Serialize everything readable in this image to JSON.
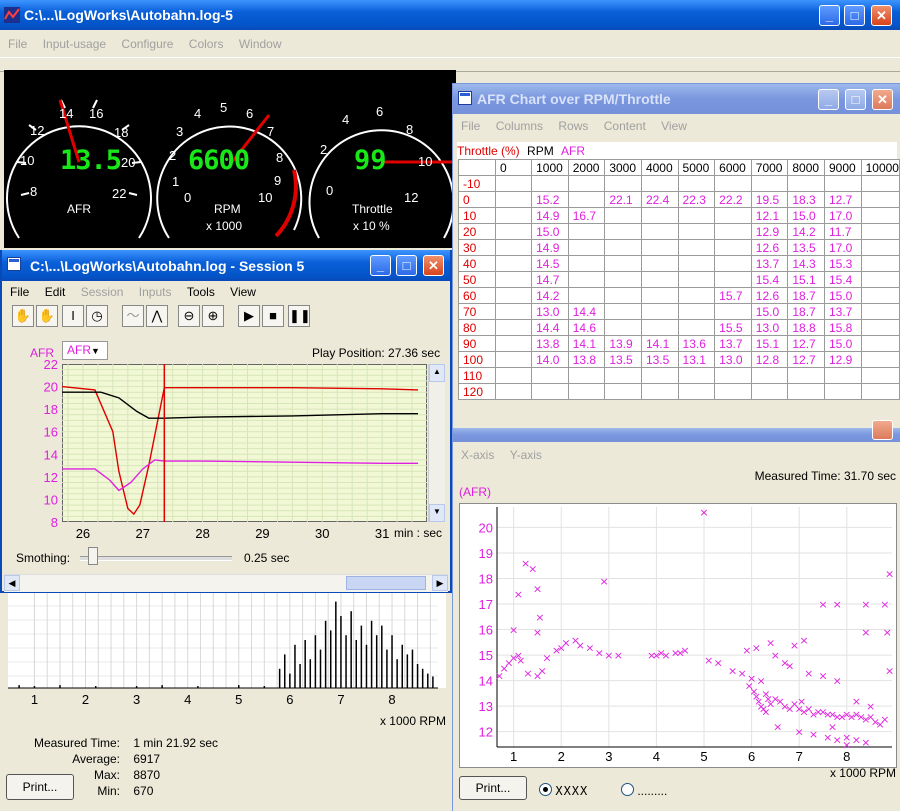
{
  "main_window": {
    "title": "C:\\...\\LogWorks\\Autobahn.log-5",
    "menu": [
      "File",
      "Input-usage",
      "Configure",
      "Colors",
      "Window"
    ],
    "min": "_",
    "max": "□",
    "close": "✕"
  },
  "gauges": {
    "afr": {
      "value": "13.5",
      "label": "AFR",
      "ticks": [
        "8",
        "10",
        "12",
        "14",
        "16",
        "18",
        "20",
        "22"
      ]
    },
    "rpm": {
      "value": "6600",
      "label": "RPM",
      "sub": "x 1000",
      "ticks": [
        "0",
        "1",
        "2",
        "3",
        "4",
        "5",
        "6",
        "7",
        "8",
        "9",
        "10"
      ]
    },
    "throttle": {
      "value": "99",
      "label": "Throttle",
      "sub": "x 10 %",
      "ticks": [
        "0",
        "2",
        "4",
        "6",
        "8",
        "10",
        "12"
      ]
    }
  },
  "afr_chart_window": {
    "title": "AFR Chart over RPM/Throttle",
    "menu": [
      "File",
      "Columns",
      "Rows",
      "Content",
      "View"
    ],
    "legend": {
      "throttle": "Throttle (%)",
      "rpm": "RPM",
      "afr": "AFR"
    },
    "columns": [
      "0",
      "1000",
      "2000",
      "3000",
      "4000",
      "5000",
      "6000",
      "7000",
      "8000",
      "9000",
      "10000"
    ],
    "rows": [
      {
        "label": "-10",
        "cells": [
          "",
          "",
          "",
          "",
          "",
          "",
          "",
          "",
          "",
          "",
          ""
        ]
      },
      {
        "label": "0",
        "cells": [
          "",
          "15.2",
          "",
          "22.1",
          "22.4",
          "22.3",
          "22.2",
          "19.5",
          "18.3",
          "12.7",
          ""
        ]
      },
      {
        "label": "10",
        "cells": [
          "",
          "14.9",
          "16.7",
          "",
          "",
          "",
          "",
          "12.1",
          "15.0",
          "17.0",
          ""
        ]
      },
      {
        "label": "20",
        "cells": [
          "",
          "15.0",
          "",
          "",
          "",
          "",
          "",
          "12.9",
          "14.2",
          "11.7",
          ""
        ]
      },
      {
        "label": "30",
        "cells": [
          "",
          "14.9",
          "",
          "",
          "",
          "",
          "",
          "12.6",
          "13.5",
          "17.0",
          ""
        ]
      },
      {
        "label": "40",
        "cells": [
          "",
          "14.5",
          "",
          "",
          "",
          "",
          "",
          "13.7",
          "14.3",
          "15.3",
          ""
        ]
      },
      {
        "label": "50",
        "cells": [
          "",
          "14.7",
          "",
          "",
          "",
          "",
          "",
          "15.4",
          "15.1",
          "15.4",
          ""
        ]
      },
      {
        "label": "60",
        "cells": [
          "",
          "14.2",
          "",
          "",
          "",
          "",
          "15.7",
          "12.6",
          "18.7",
          "15.0",
          ""
        ]
      },
      {
        "label": "70",
        "cells": [
          "",
          "13.0",
          "14.4",
          "",
          "",
          "",
          "",
          "15.0",
          "18.7",
          "13.7",
          ""
        ]
      },
      {
        "label": "80",
        "cells": [
          "",
          "14.4",
          "14.6",
          "",
          "",
          "",
          "15.5",
          "13.0",
          "18.8",
          "15.8",
          ""
        ]
      },
      {
        "label": "90",
        "cells": [
          "",
          "13.8",
          "14.1",
          "13.9",
          "14.1",
          "13.6",
          "13.7",
          "15.1",
          "12.7",
          "15.0",
          ""
        ]
      },
      {
        "label": "100",
        "cells": [
          "",
          "14.0",
          "13.8",
          "13.5",
          "13.5",
          "13.1",
          "13.0",
          "12.8",
          "12.7",
          "12.9",
          ""
        ]
      },
      {
        "label": "110",
        "cells": [
          "",
          "",
          "",
          "",
          "",
          "",
          "",
          "",
          "",
          "",
          ""
        ]
      },
      {
        "label": "120",
        "cells": [
          "",
          "",
          "",
          "",
          "",
          "",
          "",
          "",
          "",
          "",
          ""
        ]
      }
    ]
  },
  "session_window": {
    "title": "C:\\...\\LogWorks\\Autobahn.log - Session 5",
    "menu": [
      {
        "label": "File",
        "enabled": true
      },
      {
        "label": "Edit",
        "enabled": true
      },
      {
        "label": "Session",
        "enabled": false
      },
      {
        "label": "Inputs",
        "enabled": false
      },
      {
        "label": "Tools",
        "enabled": true
      },
      {
        "label": "View",
        "enabled": true
      }
    ],
    "channel_label": "AFR",
    "channel_select": "AFR",
    "play_position": "Play Position: 27.36 sec",
    "x_ticks": [
      "26",
      "27",
      "28",
      "29",
      "30",
      "31"
    ],
    "x_unit": "min : sec",
    "y_ticks": [
      "22",
      "20",
      "18",
      "16",
      "14",
      "12",
      "10",
      "8"
    ],
    "smoothing_label": "Smothing:",
    "smoothing_value": "0.25 sec",
    "smoothing_level": 0.05
  },
  "histogram_panel": {
    "x_ticks": [
      "1",
      "2",
      "3",
      "4",
      "5",
      "6",
      "7",
      "8"
    ],
    "x_unit": "x 1000 RPM",
    "stats": [
      {
        "label": "Measured Time:",
        "value": "1 min 21.92 sec"
      },
      {
        "label": "Average:",
        "value": "6917"
      },
      {
        "label": "Max:",
        "value": "8870"
      },
      {
        "label": "Min:",
        "value": "670"
      }
    ],
    "print_label": "Print..."
  },
  "xy_plot_window": {
    "menu": [
      "X-axis",
      "Y-axis"
    ],
    "measured_time": "Measured Time: 31.70 sec",
    "y_label": "(AFR)",
    "x_unit": "x 1000 RPM",
    "print_label": "Print...",
    "radio_1": "XXXX",
    "radio_2": "........."
  },
  "chart_data": [
    {
      "type": "line",
      "xlabel": "min : sec",
      "ylabel": "AFR",
      "x": [
        "26",
        "27",
        "28",
        "29",
        "30",
        "31"
      ],
      "ylim": [
        8,
        22
      ],
      "series": [
        {
          "color": "#e00000",
          "points": [
            [
              25.65,
              20.0
            ],
            [
              26.2,
              19.7
            ],
            [
              26.5,
              16.0
            ],
            [
              26.6,
              12.5
            ],
            [
              26.75,
              9.2
            ],
            [
              26.85,
              8.7
            ],
            [
              26.95,
              9.5
            ],
            [
              27.1,
              13.0
            ],
            [
              27.25,
              17.0
            ],
            [
              27.36,
              19.9
            ],
            [
              28.0,
              19.9
            ],
            [
              29.5,
              19.9
            ],
            [
              31.0,
              19.8
            ],
            [
              31.6,
              19.7
            ]
          ]
        },
        {
          "color": "#000000",
          "points": [
            [
              25.65,
              19.5
            ],
            [
              26.3,
              19.5
            ],
            [
              26.6,
              19.0
            ],
            [
              26.9,
              17.8
            ],
            [
              27.1,
              17.2
            ],
            [
              27.36,
              17.2
            ],
            [
              28.0,
              17.3
            ],
            [
              29.5,
              17.4
            ],
            [
              31.0,
              17.6
            ],
            [
              31.6,
              17.6
            ]
          ]
        },
        {
          "color": "#e020e0",
          "points": [
            [
              25.65,
              12.7
            ],
            [
              26.2,
              12.7
            ],
            [
              26.45,
              11.7
            ],
            [
              26.6,
              10.8
            ],
            [
              26.8,
              11.5
            ],
            [
              27.0,
              12.7
            ],
            [
              27.2,
              13.5
            ],
            [
              27.36,
              13.4
            ],
            [
              28.0,
              13.4
            ],
            [
              29.5,
              13.3
            ],
            [
              31.0,
              13.2
            ],
            [
              31.6,
              13.2
            ]
          ]
        }
      ]
    },
    {
      "type": "bar",
      "xlabel": "x 1000 RPM",
      "xlim": [
        0.6,
        8.9
      ],
      "ylim": [
        0,
        100
      ],
      "bars": [
        [
          0.7,
          3
        ],
        [
          1.0,
          2
        ],
        [
          1.5,
          3
        ],
        [
          2.2,
          2
        ],
        [
          3.0,
          2
        ],
        [
          3.5,
          3
        ],
        [
          4.2,
          2
        ],
        [
          5.0,
          3
        ],
        [
          5.5,
          2
        ],
        [
          5.8,
          20
        ],
        [
          5.9,
          35
        ],
        [
          6.0,
          15
        ],
        [
          6.1,
          45
        ],
        [
          6.2,
          25
        ],
        [
          6.3,
          50
        ],
        [
          6.4,
          30
        ],
        [
          6.5,
          55
        ],
        [
          6.6,
          40
        ],
        [
          6.7,
          70
        ],
        [
          6.8,
          60
        ],
        [
          6.9,
          90
        ],
        [
          7.0,
          75
        ],
        [
          7.1,
          55
        ],
        [
          7.2,
          80
        ],
        [
          7.3,
          50
        ],
        [
          7.4,
          65
        ],
        [
          7.5,
          45
        ],
        [
          7.6,
          70
        ],
        [
          7.7,
          55
        ],
        [
          7.8,
          65
        ],
        [
          7.9,
          40
        ],
        [
          8.0,
          55
        ],
        [
          8.1,
          30
        ],
        [
          8.2,
          45
        ],
        [
          8.3,
          35
        ],
        [
          8.4,
          40
        ],
        [
          8.5,
          25
        ],
        [
          8.6,
          20
        ],
        [
          8.7,
          15
        ],
        [
          8.8,
          12
        ]
      ]
    },
    {
      "type": "scatter",
      "xlabel": "x 1000 RPM",
      "ylabel": "(AFR)",
      "x_ticks": [
        "1",
        "2",
        "3",
        "4",
        "5",
        "6",
        "7",
        "8"
      ],
      "y_ticks": [
        "12",
        "13",
        "14",
        "15",
        "16",
        "17",
        "18",
        "19",
        "20"
      ],
      "xlim": [
        0.65,
        8.95
      ],
      "ylim": [
        11.4,
        20.8
      ],
      "points": [
        [
          0.7,
          14.2
        ],
        [
          0.8,
          14.5
        ],
        [
          0.9,
          14.7
        ],
        [
          1.0,
          14.9
        ],
        [
          1.1,
          15.0
        ],
        [
          1.15,
          14.8
        ],
        [
          1.0,
          16.0
        ],
        [
          1.1,
          17.4
        ],
        [
          1.25,
          18.6
        ],
        [
          1.4,
          18.4
        ],
        [
          1.5,
          17.6
        ],
        [
          1.55,
          16.5
        ],
        [
          1.5,
          15.9
        ],
        [
          1.3,
          14.3
        ],
        [
          1.5,
          14.2
        ],
        [
          1.6,
          14.4
        ],
        [
          1.7,
          14.9
        ],
        [
          1.9,
          15.2
        ],
        [
          2.0,
          15.3
        ],
        [
          2.1,
          15.5
        ],
        [
          2.3,
          15.6
        ],
        [
          2.4,
          15.4
        ],
        [
          2.6,
          15.3
        ],
        [
          2.8,
          15.1
        ],
        [
          2.9,
          17.9
        ],
        [
          3.0,
          15.0
        ],
        [
          3.2,
          15.0
        ],
        [
          3.9,
          15.0
        ],
        [
          4.0,
          15.0
        ],
        [
          4.1,
          15.1
        ],
        [
          4.2,
          15.0
        ],
        [
          4.4,
          15.1
        ],
        [
          4.5,
          15.1
        ],
        [
          4.6,
          15.2
        ],
        [
          5.0,
          20.6
        ],
        [
          5.1,
          14.8
        ],
        [
          5.3,
          14.7
        ],
        [
          5.6,
          14.4
        ],
        [
          5.8,
          14.3
        ],
        [
          5.9,
          15.2
        ],
        [
          6.1,
          15.3
        ],
        [
          6.4,
          15.5
        ],
        [
          6.5,
          15.0
        ],
        [
          6.2,
          14.0
        ],
        [
          5.95,
          13.8
        ],
        [
          6.0,
          14.1
        ],
        [
          6.05,
          13.6
        ],
        [
          6.1,
          13.4
        ],
        [
          6.15,
          13.2
        ],
        [
          6.2,
          13.0
        ],
        [
          6.25,
          12.9
        ],
        [
          6.3,
          13.5
        ],
        [
          6.35,
          13.3
        ],
        [
          6.4,
          13.1
        ],
        [
          6.5,
          13.3
        ],
        [
          6.6,
          13.2
        ],
        [
          6.7,
          13.0
        ],
        [
          6.8,
          12.9
        ],
        [
          6.9,
          13.1
        ],
        [
          7.0,
          12.9
        ],
        [
          7.05,
          13.2
        ],
        [
          7.1,
          12.8
        ],
        [
          7.2,
          12.9
        ],
        [
          7.3,
          12.7
        ],
        [
          7.4,
          12.8
        ],
        [
          7.5,
          12.8
        ],
        [
          7.6,
          12.7
        ],
        [
          7.7,
          12.7
        ],
        [
          7.8,
          12.6
        ],
        [
          7.9,
          12.6
        ],
        [
          8.0,
          12.7
        ],
        [
          8.1,
          12.6
        ],
        [
          8.2,
          12.7
        ],
        [
          8.3,
          12.6
        ],
        [
          8.4,
          12.5
        ],
        [
          8.5,
          12.6
        ],
        [
          8.6,
          12.4
        ],
        [
          8.7,
          12.3
        ],
        [
          8.8,
          12.5
        ],
        [
          6.3,
          12.8
        ],
        [
          6.55,
          12.2
        ],
        [
          7.0,
          12.0
        ],
        [
          7.3,
          11.9
        ],
        [
          7.6,
          11.8
        ],
        [
          7.8,
          11.7
        ],
        [
          8.0,
          11.8
        ],
        [
          8.2,
          11.7
        ],
        [
          8.4,
          11.6
        ],
        [
          8.0,
          11.5
        ],
        [
          7.7,
          12.2
        ],
        [
          7.5,
          17.0
        ],
        [
          7.8,
          17.0
        ],
        [
          8.4,
          17.0
        ],
        [
          8.8,
          17.0
        ],
        [
          8.85,
          15.9
        ],
        [
          8.9,
          18.2
        ],
        [
          8.9,
          14.4
        ],
        [
          8.4,
          15.9
        ],
        [
          7.1,
          15.6
        ],
        [
          6.9,
          15.4
        ],
        [
          6.7,
          14.7
        ],
        [
          6.8,
          14.6
        ],
        [
          7.2,
          14.3
        ],
        [
          7.5,
          14.2
        ],
        [
          7.8,
          14.0
        ],
        [
          8.2,
          13.2
        ],
        [
          8.5,
          13.0
        ]
      ]
    }
  ]
}
